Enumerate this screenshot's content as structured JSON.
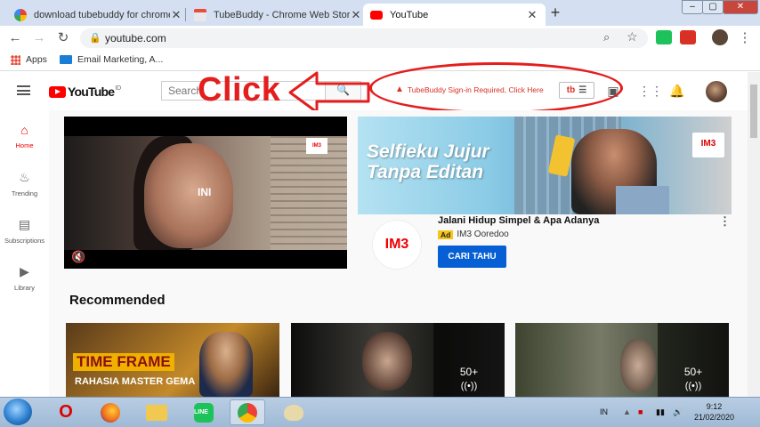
{
  "browser": {
    "tabs": [
      {
        "title": "download tubebuddy for chrome",
        "active": false
      },
      {
        "title": "TubeBuddy - Chrome Web Store",
        "active": false
      },
      {
        "title": "YouTube",
        "active": true
      }
    ],
    "url": "youtube.com",
    "bookmarks": [
      "Apps",
      "Email Marketing, A..."
    ]
  },
  "youtube": {
    "logo_text": "YouTube",
    "country_code": "ID",
    "search_placeholder": "Search",
    "tubebuddy_warning": "TubeBuddy Sign-in Required, Click Here",
    "tubebuddy_badge": "tb"
  },
  "annotation": {
    "click_text": "Click"
  },
  "sidebar": {
    "items": [
      {
        "label": "Home",
        "icon": "home-icon",
        "active": true
      },
      {
        "label": "Trending",
        "icon": "flame-icon",
        "active": false
      },
      {
        "label": "Subscriptions",
        "icon": "subscriptions-icon",
        "active": false
      },
      {
        "label": "Library",
        "icon": "library-icon",
        "active": false
      }
    ]
  },
  "ad": {
    "video_overlay_text": "INI",
    "brand_logo": "IM3",
    "banner_headline": "Selfieku Jujur\nTanpa Editan",
    "title": "Jalani Hidup Simpel & Apa Adanya",
    "badge": "Ad",
    "advertiser": "IM3 Ooredoo",
    "cta": "CARI TAHU"
  },
  "recommended": {
    "heading": "Recommended",
    "thumbnails": [
      {
        "overlay_big": "TIME FRAME",
        "overlay_small": "RAHASIA MASTER GEMA"
      },
      {
        "playlist_count": "50+"
      },
      {
        "playlist_count": "50+"
      }
    ]
  },
  "taskbar": {
    "lang": "IN",
    "time": "9:12",
    "date": "21/02/2020"
  },
  "colors": {
    "youtube_red": "#ff0000",
    "annotation_red": "#e41e1e",
    "cta_blue": "#065fd4"
  }
}
